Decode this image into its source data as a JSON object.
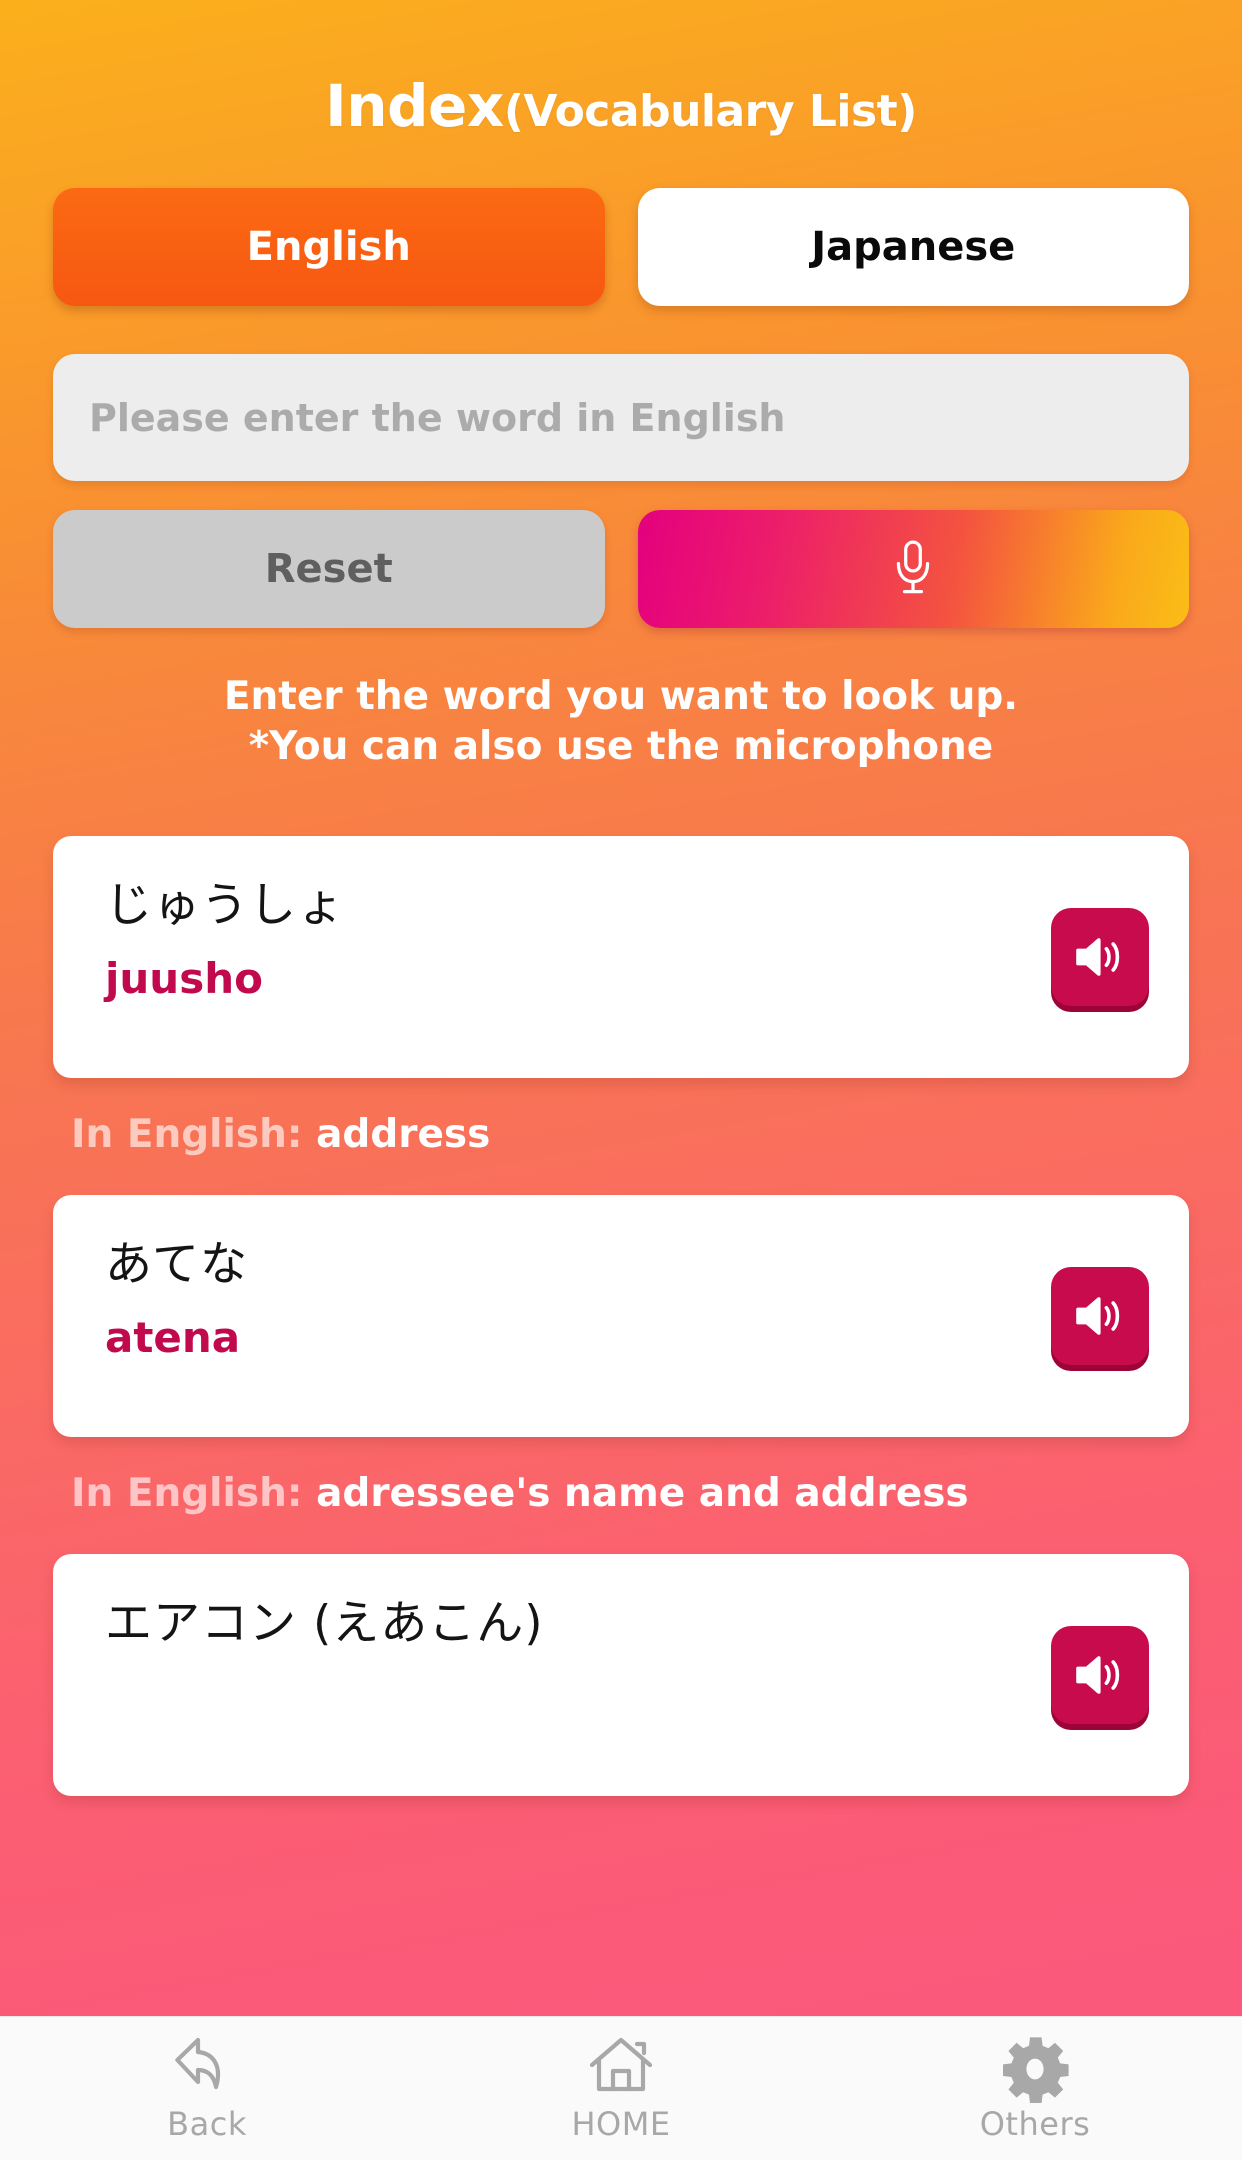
{
  "header": {
    "title_main": "Index",
    "title_sub": "(Vocabulary List)"
  },
  "language_toggle": {
    "selected": "English",
    "options": [
      {
        "label": "English",
        "active": true
      },
      {
        "label": "Japanese",
        "active": false
      }
    ],
    "active_bg": "#F75712",
    "inactive_bg": "#FFFFFF"
  },
  "search": {
    "value": "",
    "placeholder": "Please enter the word in English"
  },
  "actions": {
    "reset_label": "Reset",
    "mic_icon": "microphone-icon",
    "reset_bg": "#CBCBCB",
    "mic_gradient_from": "#E4007E",
    "mic_gradient_to": "#FBBD16"
  },
  "instructions": {
    "line1": "Enter the word you want to look up.",
    "line2": "*You can also use the microphone"
  },
  "vocab_list": {
    "meaning_label": "In English:",
    "speaker_icon": "speaker-icon",
    "accent_color": "#C80B4C",
    "items": [
      {
        "kana": "じゅうしょ",
        "romaji": "juusho",
        "meaning": "address"
      },
      {
        "kana": "あてな",
        "romaji": "atena",
        "meaning": "adressee's name and address"
      },
      {
        "kana": "エアコン (えあこん)",
        "romaji": "",
        "meaning": ""
      }
    ]
  },
  "bottom_nav": {
    "items": [
      {
        "label": "Back",
        "icon": "back-arrow-icon"
      },
      {
        "label": "HOME",
        "icon": "home-icon"
      },
      {
        "label": "Others",
        "icon": "gear-icon"
      }
    ],
    "icon_color": "#A8A8A8"
  }
}
